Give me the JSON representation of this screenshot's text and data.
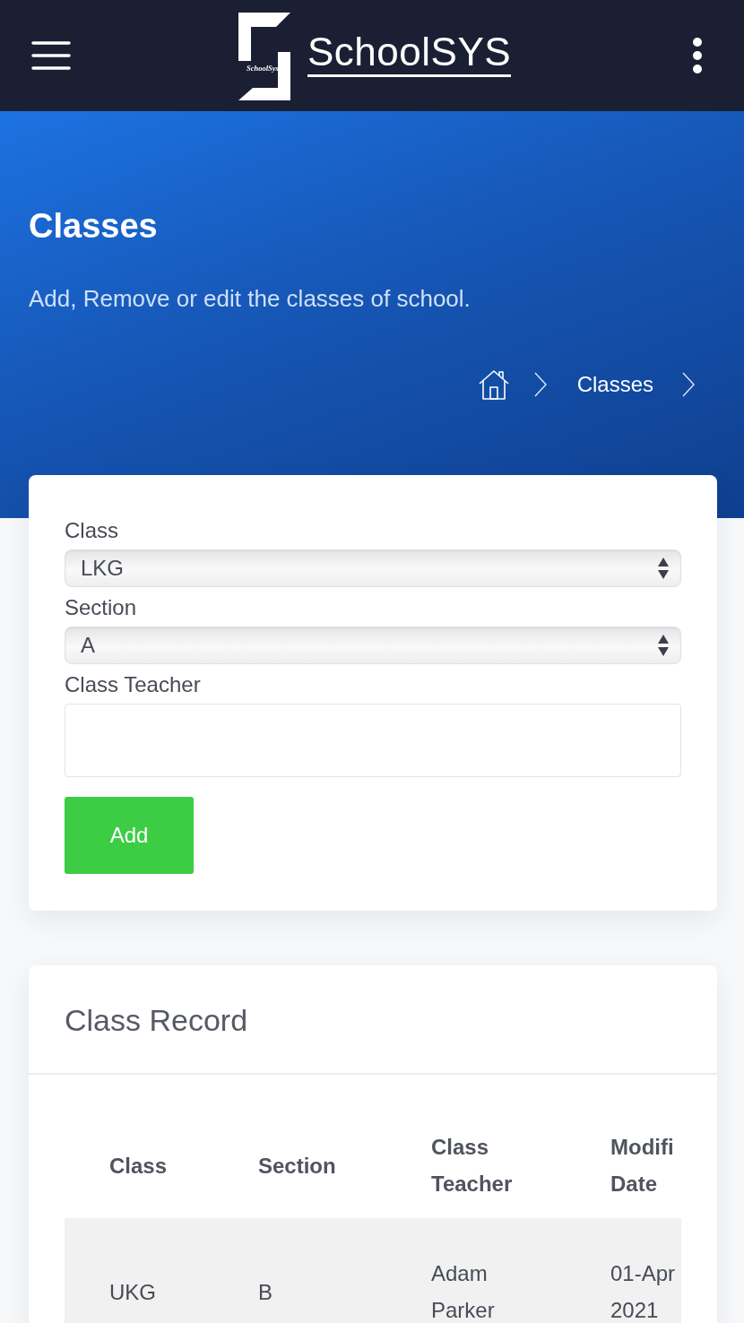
{
  "header": {
    "logo_mark_text": "SchoolSys",
    "logo_text": "SchoolSYS"
  },
  "hero": {
    "title": "Classes",
    "subtitle": "Add, Remove or edit the classes of school.",
    "breadcrumb": [
      "Classes"
    ]
  },
  "form": {
    "fields": [
      {
        "kind": "select",
        "label": "Class",
        "value": "LKG"
      },
      {
        "kind": "select",
        "label": "Section",
        "value": "A"
      },
      {
        "kind": "text",
        "label": "Class Teacher"
      }
    ],
    "button": "Add"
  },
  "record": {
    "title": "Class Record",
    "table": {
      "columns": [
        "Class",
        "Section",
        "Class Teacher",
        "Modifi Date"
      ],
      "rows": [
        [
          "UKG",
          "B",
          "Adam Parker",
          "01-Apr 2021"
        ]
      ]
    }
  }
}
